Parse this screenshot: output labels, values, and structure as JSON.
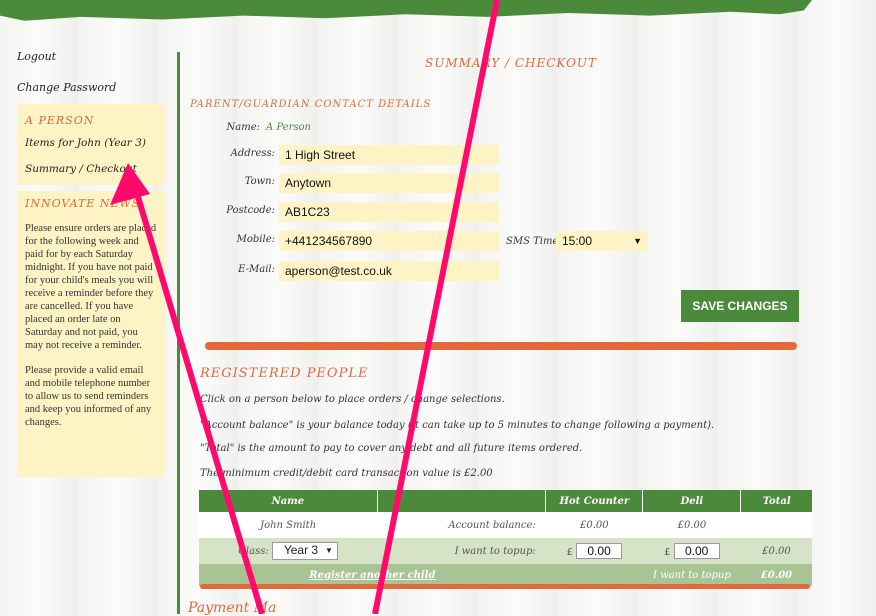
{
  "sidebar": {
    "logout": "Logout",
    "change_password": "Change Password",
    "person_title": "A PERSON",
    "items_link": "Items for John (Year 3)",
    "summary_link": "Summary / Checkout",
    "news_title": "INNOVATE NEWS",
    "news_p1": "Please ensure orders are placed for the following week and paid for by each Saturday midnight. If you have not paid for your child's meals you will receive a reminder before they are cancelled. If you have placed an order late on Saturday and not paid, you may not receive a reminder.",
    "news_p2": "Please provide a valid email and mobile telephone number to allow us to send reminders and keep you informed of any changes."
  },
  "main": {
    "heading": "SUMMARY / CHECKOUT",
    "contact_title": "PARENT/GUARDIAN CONTACT DETAILS",
    "name_label": "Name:",
    "name_value": "A Person",
    "address_label": "Address:",
    "address_value": "1 High Street",
    "town_label": "Town:",
    "town_value": "Anytown",
    "postcode_label": "Postcode:",
    "postcode_value": "AB1C23",
    "mobile_label": "Mobile:",
    "mobile_value": "+441234567890",
    "sms_label": "SMS Time:",
    "sms_value": "15:00",
    "email_label": "E-Mail:",
    "email_value": "aperson@test.co.uk",
    "save_button": "SAVE CHANGES"
  },
  "registered": {
    "title": "REGISTERED PEOPLE",
    "p1": "Click on a person below to place orders / change selections.",
    "p2": "\"Account balance\" is your balance today (it can take up to 5 minutes to change following a payment).",
    "p3": "\"Total\" is the amount to pay to cover any debt and all future items ordered.",
    "p4": "The minimum credit/debit card transaction value is £2.00",
    "headers": [
      "Name",
      "",
      "Hot Counter",
      "Deli",
      "Total"
    ],
    "person_name": "John Smith",
    "account_balance_label": "Account balance:",
    "hot_balance": "£0.00",
    "deli_balance": "£0.00",
    "class_label": "Class:",
    "class_value": "Year 3",
    "topup_label": "I want to topup:",
    "currency": "£",
    "hot_topup": "0.00",
    "deli_topup": "0.00",
    "row_total": "£0.00",
    "register_link": "Register another child",
    "want_topup": "I want to topup",
    "grand_total": "£0.00"
  },
  "bottom": {
    "heading": "Payment Ma"
  },
  "colors": {
    "green": "#4b8a3a",
    "orange": "#e06a3c",
    "cream": "#fdf3c4",
    "arrow": "#ff0a6c"
  }
}
